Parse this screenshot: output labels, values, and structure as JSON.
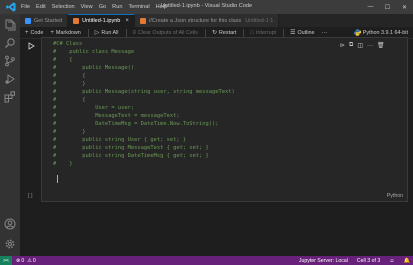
{
  "window": {
    "title": "Untitled-1.ipynb - Visual Studio Code",
    "controls": {
      "minimize": "—",
      "maximize": "☐",
      "close": "✕"
    }
  },
  "menu": [
    "File",
    "Edit",
    "Selection",
    "View",
    "Go",
    "Run",
    "Terminal",
    "Help"
  ],
  "tabs": [
    {
      "label": "Get Started",
      "icon_color": "#3794ff",
      "active": false
    },
    {
      "label": "Untitled-1.ipynb",
      "icon_color": "#e37933",
      "active": true,
      "close": "×"
    },
    {
      "label": "//Create a Json structure for this class",
      "suffix": "Untitled-1 1",
      "icon_color": "#e37933",
      "active": false
    }
  ],
  "toolbar": {
    "code": "Code",
    "markdown": "Markdown",
    "run_all": "Run All",
    "clear_outputs": "Clear Outputs of All Cells",
    "restart": "Restart",
    "interrupt": "Interrupt",
    "outline": "Outline",
    "kernel": "Python 3.9.1 64-bit"
  },
  "cell": {
    "code_lines": [
      "#C# Class",
      "#    public class Message",
      "#    {",
      "#        public Message()",
      "#        {",
      "#        }",
      "#        public Message(string user, string messageText)",
      "#        {",
      "#            User = user;",
      "#            MessageText = messageText;",
      "#            DateTimeMsg = DateTime.Now.ToString();",
      "#        }",
      "#        public string User { get; set; }",
      "#        public string MessageText { get; set; }",
      "#        public string DateTimeMsg { get; set; }",
      "#    }"
    ],
    "language": "Python",
    "exec_count": "[ ]"
  },
  "statusbar": {
    "remote": "><",
    "errors": "0",
    "warnings": "0",
    "jupyter": "Jupyter Server: Local",
    "cell_position": "Cell 3 of 3"
  },
  "colors": {
    "accent": "#0e70c0",
    "statusbar": "#68217a",
    "comment": "#6a9955"
  }
}
